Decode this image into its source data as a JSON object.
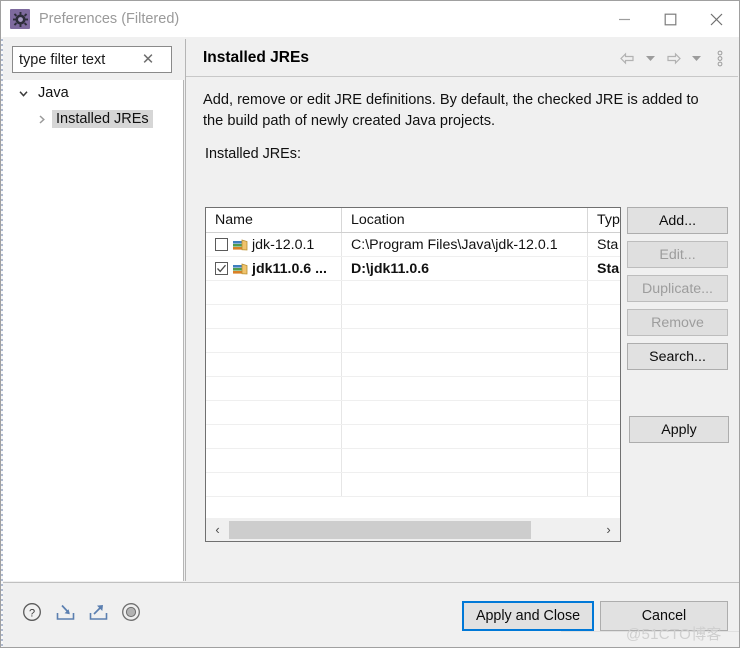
{
  "window": {
    "title": "Preferences (Filtered)",
    "icon": "preferences-gear-icon",
    "controls": {
      "minimize": "–",
      "maximize": "□",
      "close": "✕"
    }
  },
  "filter": {
    "value": "",
    "placeholder": "type filter text",
    "clear_glyph": "✕"
  },
  "tree": {
    "items": [
      {
        "label": "Java",
        "level": 0,
        "expanded": true,
        "selected": false
      },
      {
        "label": "Installed JREs",
        "level": 1,
        "expanded": false,
        "selected": true
      }
    ]
  },
  "page": {
    "title": "Installed JREs",
    "description": "Add, remove or edit JRE definitions. By default, the checked JRE is added to the build path of newly created Java projects.",
    "list_label": "Installed JREs:",
    "nav": {
      "back": "back-arrow-icon",
      "back_menu": "chevron-down-icon",
      "forward": "forward-arrow-icon",
      "forward_menu": "chevron-down-icon",
      "view_menu": "view-menu-icon"
    }
  },
  "table": {
    "columns": [
      "Name",
      "Location",
      "Typ"
    ],
    "rows": [
      {
        "checked": false,
        "bold": false,
        "name": "jdk-12.0.1",
        "location": "C:\\Program Files\\Java\\jdk-12.0.1",
        "type": "Sta"
      },
      {
        "checked": true,
        "bold": true,
        "name": "jdk11.0.6 ...",
        "location": "D:\\jdk11.0.6",
        "type": "Sta"
      }
    ],
    "empty_row_count": 9,
    "scrollbar": {
      "left_glyph": "‹",
      "right_glyph": "›",
      "thumb_percent": 82
    }
  },
  "side_buttons": [
    {
      "label": "Add...",
      "enabled": true
    },
    {
      "label": "Edit...",
      "enabled": false
    },
    {
      "label": "Duplicate...",
      "enabled": false
    },
    {
      "label": "Remove",
      "enabled": false
    },
    {
      "label": "Search...",
      "enabled": true
    }
  ],
  "apply_button": {
    "label": "Apply",
    "enabled": true
  },
  "bottom": {
    "icons": [
      {
        "name": "help-icon"
      },
      {
        "name": "import-icon"
      },
      {
        "name": "export-icon"
      },
      {
        "name": "restore-defaults-icon"
      }
    ],
    "apply_and_close": "Apply and Close",
    "cancel": "Cancel"
  },
  "watermark": "@51CTO博客",
  "colors": {
    "accent": "#0078d7",
    "title_text": "#9a9a9a",
    "app_icon_bg": "#7e6a9e",
    "panel_bg": "#f0f0f0",
    "button_bg": "#e1e1e1",
    "selection_bg": "#d6d6d6"
  }
}
